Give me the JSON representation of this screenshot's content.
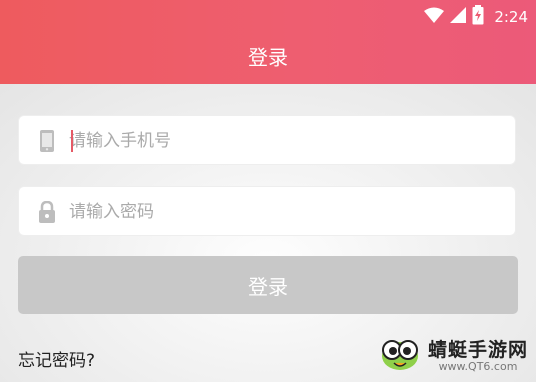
{
  "status_bar": {
    "time": "2:24",
    "icons": [
      "wifi-icon",
      "signal-icon",
      "battery-charging-icon"
    ]
  },
  "header": {
    "title": "登录"
  },
  "phone_field": {
    "placeholder": "请输入手机号",
    "value": "",
    "icon": "phone-icon"
  },
  "password_field": {
    "placeholder": "请输入密码",
    "value": "",
    "icon": "lock-icon"
  },
  "login_button": {
    "label": "登录"
  },
  "forgot_password": {
    "label": "忘记密码?"
  },
  "watermark": {
    "title": "蜻蜓手游网",
    "url": "www.QT6.com"
  },
  "colors": {
    "header_start": "#ee5b5e",
    "header_end": "#ec5a79",
    "button_disabled": "#c8c8c8",
    "caret": "#e55a66"
  }
}
